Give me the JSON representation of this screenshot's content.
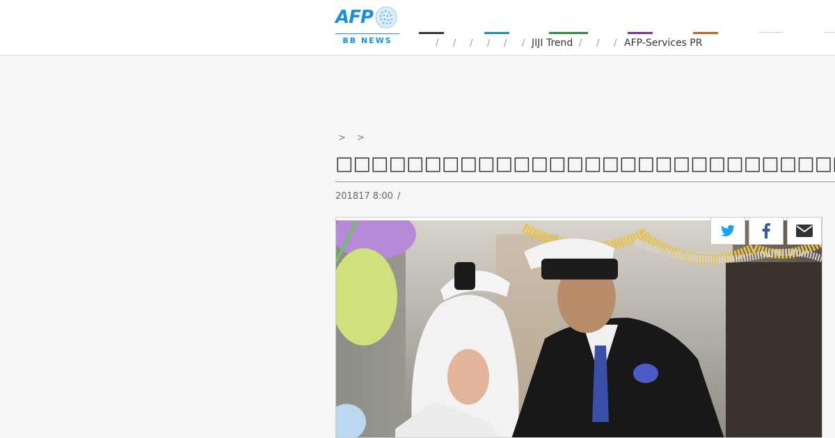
{
  "header": {
    "logo_text": "AFP",
    "logo_sub": "BB NEWS",
    "nav": [
      {
        "label": "JIJI Trend"
      },
      {
        "label": "AFP-Services PR"
      }
    ],
    "nav_colors": [
      "#333333",
      "#1b8db4",
      "#2b8a3e",
      "#7a2f95",
      "#c0641a",
      "#cccccc",
      "#cccccc"
    ]
  },
  "article": {
    "breadcrumb": "> >",
    "title": "□□□□□□□□□□□□□□□□□□□□□□□□□□□□□□□□□□□□",
    "date": "201817 8:00",
    "date_sep": "/",
    "photo_desc_icon": "wedding-photo"
  },
  "share": {
    "twitter_color": "#1da1f2",
    "facebook_color": "#3b5998",
    "mail_color": "#333333"
  }
}
